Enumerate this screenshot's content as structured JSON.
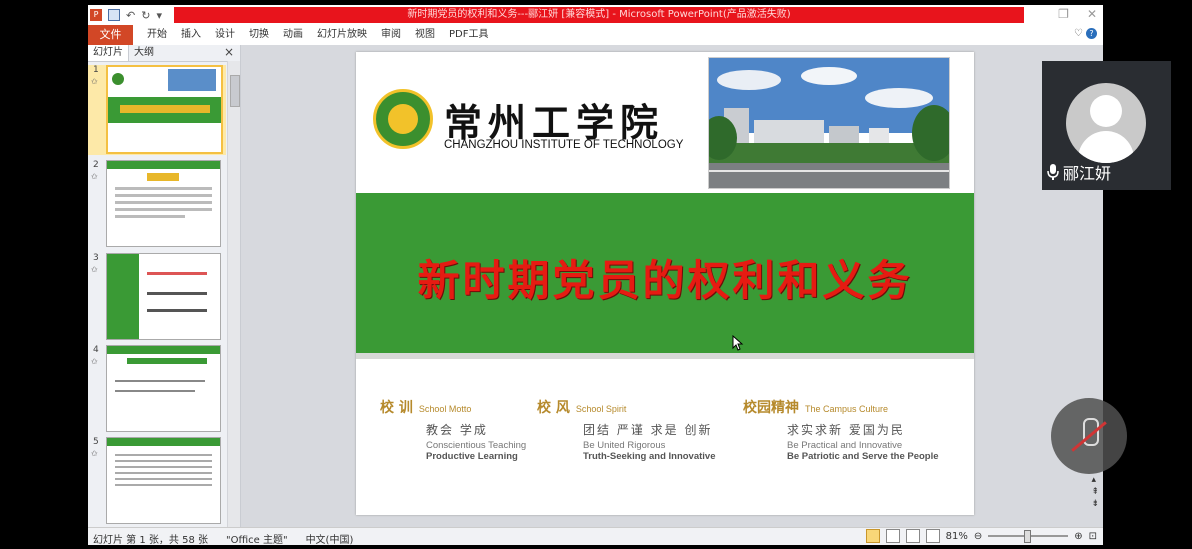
{
  "window": {
    "title": "新时期党员的权利和义务---郦江妍 [兼容模式] - Microsoft PowerPoint(产品激活失败)"
  },
  "ribbon": {
    "file_label": "文件",
    "tabs": [
      "开始",
      "插入",
      "设计",
      "切换",
      "动画",
      "幻灯片放映",
      "审阅",
      "视图",
      "PDF工具"
    ]
  },
  "left_pane": {
    "tab_slides": "幻灯片",
    "tab_outline": "大纲",
    "close": "×",
    "thumbnails": [
      {
        "num": "1",
        "selected": true
      },
      {
        "num": "2",
        "selected": false
      },
      {
        "num": "3",
        "selected": false
      },
      {
        "num": "4",
        "selected": false
      },
      {
        "num": "5",
        "selected": false
      }
    ]
  },
  "slide": {
    "school_cn": "常州工学院",
    "school_en": "CHANGZHOU INSTITUTE OF TECHNOLOGY",
    "main_title": "新时期党员的权利和义务",
    "motto": {
      "head": "校 训",
      "head_en": "School Motto",
      "cn": "教会   学成",
      "en1": "Conscientious Teaching",
      "en2": "Productive Learning"
    },
    "spirit": {
      "head": "校 风",
      "head_en": "School Spirit",
      "cn": "团结   严谨   求是   创新",
      "en1": "Be United Rigorous",
      "en2": "Truth-Seeking and Innovative"
    },
    "culture": {
      "head": "校园精神",
      "head_en": "The Campus Culture",
      "cn": "求实求新   爱国为民",
      "en1": "Be Practical and Innovative",
      "en2": "Be Patriotic and Serve the People"
    }
  },
  "status_bar": {
    "slide_info": "幻灯片 第 1 张，共 58 张",
    "theme": "\"Office 主题\"",
    "language": "中文(中国)",
    "zoom": "81%"
  },
  "video": {
    "participant_name": "郦江妍"
  },
  "colors": {
    "title_bar_red": "#e8141c",
    "file_tab": "#d24726",
    "slide_green": "#3a9a35",
    "slide_title_red": "#e61b12",
    "motto_gold": "#b68a2c"
  }
}
